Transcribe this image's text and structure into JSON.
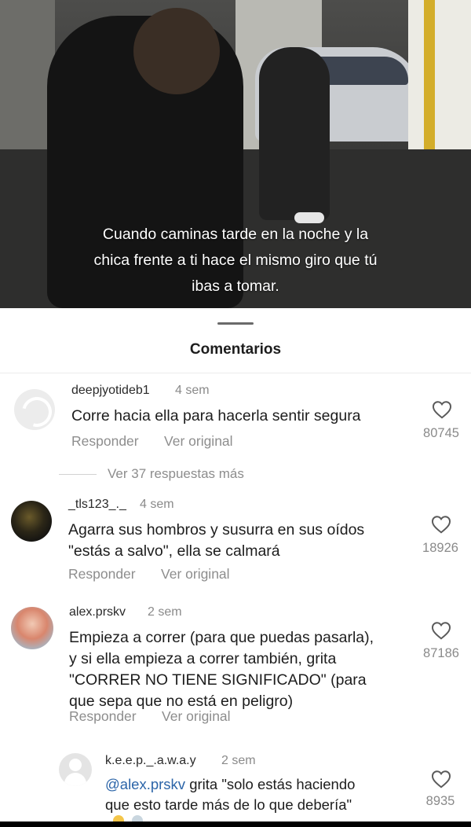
{
  "video": {
    "caption_lines": [
      "Cuando caminas tarde en la noche y la",
      "chica frente a ti hace el mismo giro que tú",
      "ibas a tomar."
    ]
  },
  "sheet": {
    "title": "Comentarios"
  },
  "comments": [
    {
      "username": "deepjyotideb1",
      "time": "4 sem",
      "lines": [
        "Corre hacia ella para hacerla sentir segura"
      ],
      "reply_label": "Responder",
      "original_label": "Ver original",
      "likes": "80745",
      "view_replies": "Ver 37 respuestas más"
    },
    {
      "username": "_tls123_._",
      "time": "4 sem",
      "lines": [
        "Agarra sus hombros y susurra en sus oídos",
        "\"estás a salvo\", ella se calmará"
      ],
      "reply_label": "Responder",
      "original_label": "Ver original",
      "likes": "18926"
    },
    {
      "username": "alex.prskv",
      "time": "2 sem",
      "lines": [
        "Empieza a correr (para que puedas pasarla),",
        "y si ella empieza a correr también, grita",
        "\"CORRER NO TIENE SIGNIFICADO\" (para",
        "que sepa que no está en peligro)"
      ],
      "reply_label": "Responder",
      "original_label": "Ver original",
      "likes": "87186"
    }
  ],
  "reply": {
    "username": "k.e.e.p._.a.w.a.y",
    "time": "2 sem",
    "mention": "@alex.prskv",
    "line1_rest": " grita \"solo estás haciendo",
    "line2": "que esto tarde más de lo que debería\"",
    "likes": "8935"
  },
  "icons": {
    "like": "heart-outline-icon",
    "avatar_default": "default-user-icon"
  },
  "colors": {
    "mention": "#2b64a8",
    "secondary_text": "#8d8d8d",
    "caption": "#ffffff"
  }
}
